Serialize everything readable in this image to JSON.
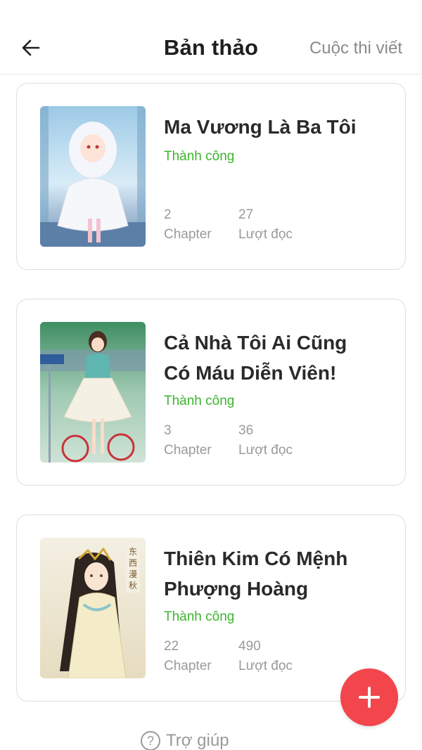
{
  "header": {
    "title": "Bản thảo",
    "contest_link": "Cuộc thi viết"
  },
  "icons": {
    "back": "arrow-left-icon",
    "fab": "plus-icon",
    "help": "question-circle-icon"
  },
  "colors": {
    "accent": "#f2454c",
    "status": "#3cb52e",
    "muted": "#9a9a9a"
  },
  "drafts": [
    {
      "title_lines": [
        "Ma Vương Là Ba Tôi"
      ],
      "status": "Thành công",
      "chapters": "2",
      "chapters_label": "Chapter",
      "reads": "27",
      "reads_label": "Lượt đọc"
    },
    {
      "title_lines": [
        "Cả Nhà Tôi Ai Cũng",
        "Có Máu Diễn Viên!"
      ],
      "status": "Thành công",
      "chapters": "3",
      "chapters_label": "Chapter",
      "reads": "36",
      "reads_label": "Lượt đọc"
    },
    {
      "title_lines": [
        "Thiên Kim Có Mệnh",
        "Phượng Hoàng"
      ],
      "status": "Thành công",
      "chapters": "22",
      "chapters_label": "Chapter",
      "reads": "490",
      "reads_label": "Lượt đọc"
    }
  ],
  "help": {
    "label": "Trợ giúp"
  }
}
